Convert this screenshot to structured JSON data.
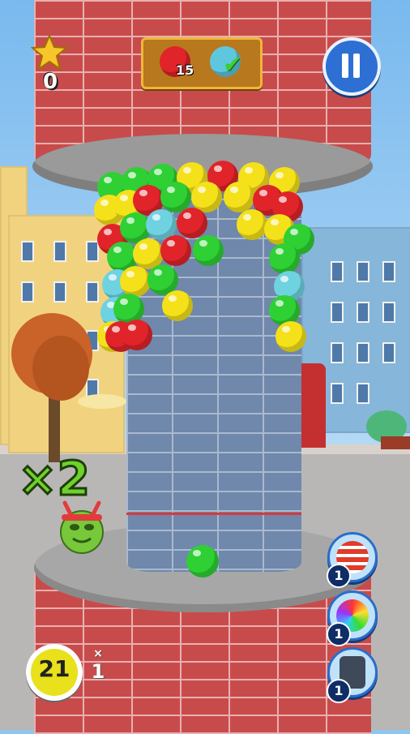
{
  "hud": {
    "star_score": "0",
    "target_red_remaining": "15",
    "target_cyan_status": "✔",
    "pause_label": "pause"
  },
  "combo": {
    "multiplier_text": "×2"
  },
  "shooter": {
    "shots_remaining": "21",
    "swap_count": "1",
    "swap_symbol": "×"
  },
  "boosters": [
    {
      "name": "firecracker",
      "count": "1"
    },
    {
      "name": "rainbow-ball",
      "count": "1"
    },
    {
      "name": "trash-bin",
      "count": "1"
    }
  ],
  "colors": {
    "red": "#e0242a",
    "green": "#2ed034",
    "yellow": "#f4e11a",
    "cyan": "#6fd2e0",
    "hud_gold": "#b8781e",
    "button_blue": "#2d6fd3"
  },
  "current_ball_color": "green"
}
